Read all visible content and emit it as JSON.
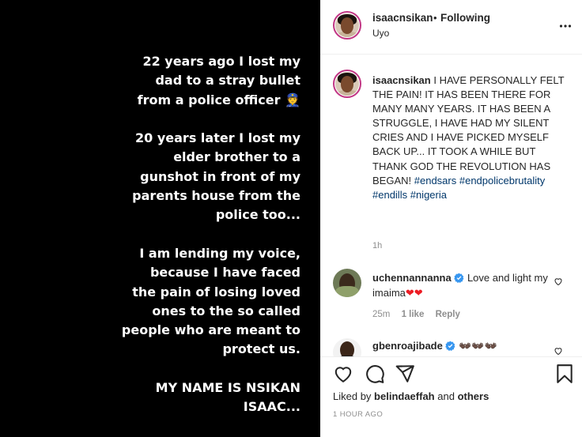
{
  "story": {
    "paragraphs": [
      [
        "22 years ago I lost my",
        "dad to a stray bullet",
        "from a police officer 👮"
      ],
      [
        "20 years later I lost my",
        "elder brother to a",
        "gunshot in front of my",
        "parents house from the",
        "police too..."
      ],
      [
        "I am lending my voice,",
        "because I have faced",
        "the pain of losing loved",
        "ones to the so called",
        "people who are meant to",
        "protect us."
      ],
      [
        "MY NAME IS NSIKAN",
        "ISAAC..."
      ]
    ]
  },
  "header": {
    "username": "isaacnsikan",
    "separator": "•",
    "follow_status": "Following",
    "location": "Uyo",
    "more_icon": "more-options-icon"
  },
  "caption": {
    "username": "isaacnsikan",
    "text": "I HAVE PERSONALLY FELT THE PAIN! IT HAS BEEN THERE FOR MANY MANY YEARS. IT HAS BEEN A STRUGGLE, I HAVE HAD MY SILENT CRIES AND I HAVE PICKED MYSELF BACK UP... IT TOOK A WHILE BUT THANK GOD THE REVOLUTION HAS BEGAN!",
    "hashtags": [
      "#endsars",
      "#endpolicebrutality",
      "#endills",
      "#nigeria"
    ],
    "time": "1h"
  },
  "comments": [
    {
      "username": "uchennannanna",
      "verified": true,
      "text": "Love and light my imaima",
      "emoji": "❤❤",
      "time": "25m",
      "likes": "1 like",
      "reply": "Reply"
    },
    {
      "username": "gbenroajibade",
      "verified": true,
      "emoji": "👐🏿👐🏿👐🏿"
    }
  ],
  "actions": {
    "icons": [
      "heart-icon",
      "comment-icon",
      "share-icon",
      "bookmark-icon"
    ],
    "liked_by_prefix": "Liked by",
    "liked_by_user": "belindaeffah",
    "liked_by_and": "and",
    "liked_by_others": "others",
    "post_time": "1 HOUR AGO"
  },
  "colors": {
    "accent_link": "#00376b",
    "verified": "#3897f0",
    "story_ring": "#c13584",
    "heart_red": "#ed1c24"
  }
}
